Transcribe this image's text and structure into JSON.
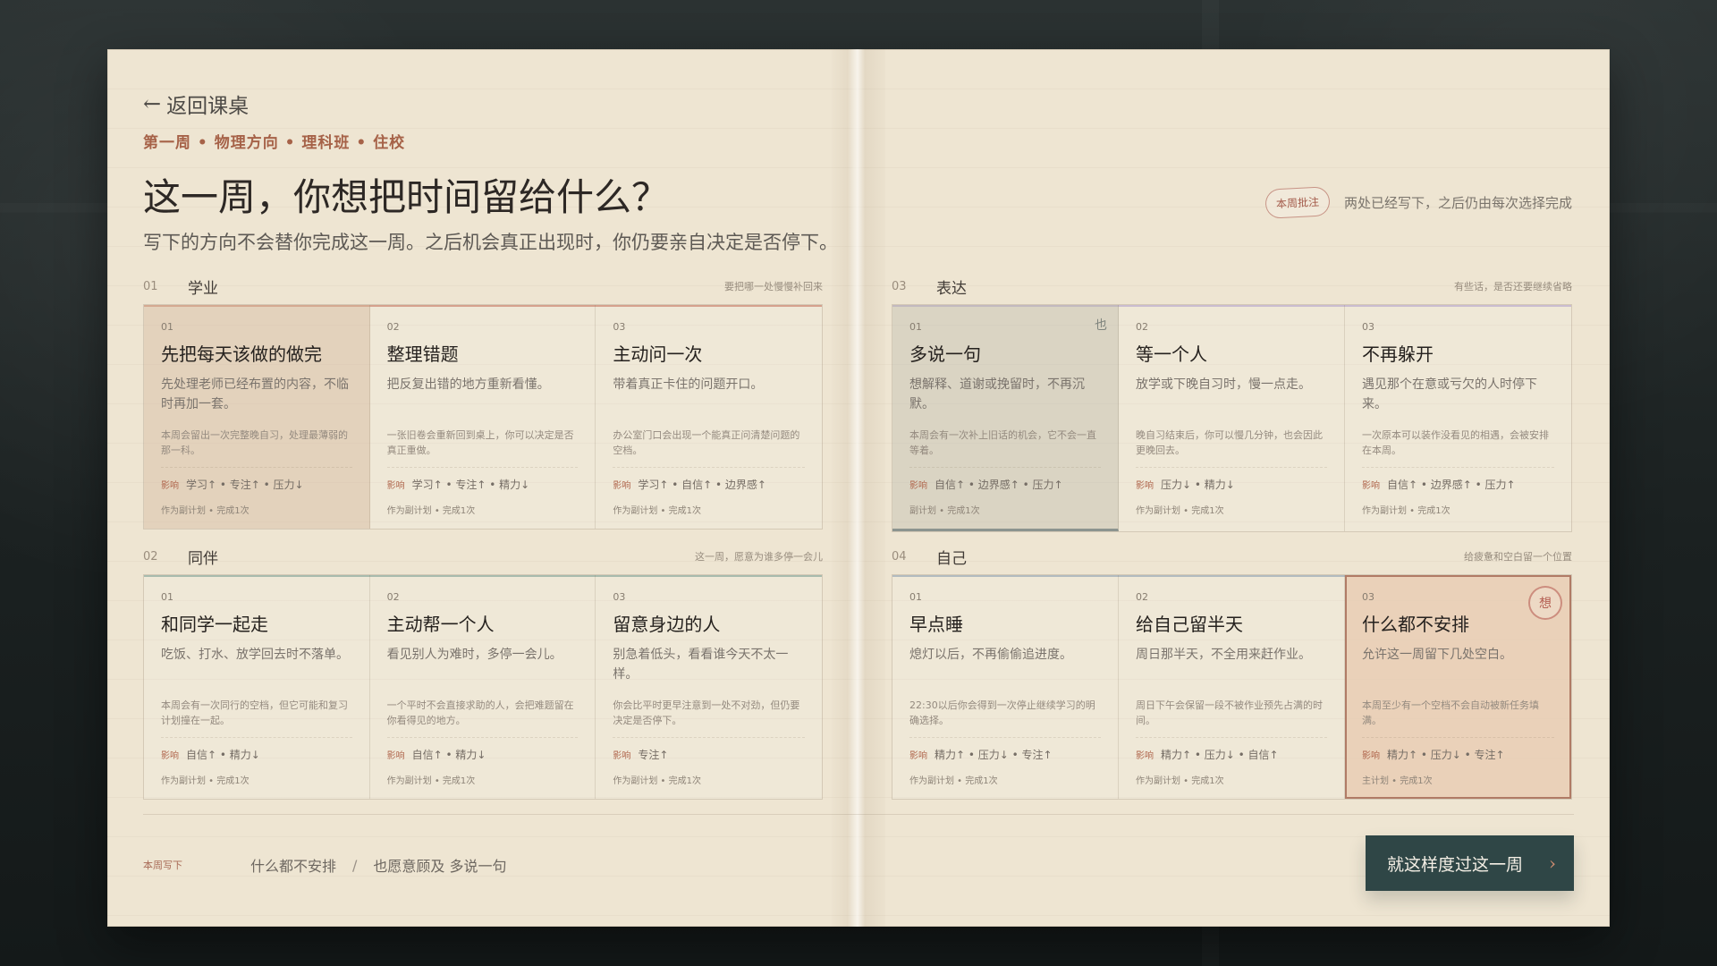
{
  "header": {
    "back_label": "返回课桌",
    "meta": "第一周 • 物理方向 • 理科班 • 住校",
    "title": "这一周，你想把时间留给什么？",
    "subtitle": "写下的方向不会替你完成这一周。之后机会真正出现时，你仍要亲自决定是否停下。"
  },
  "note": {
    "stamp": "本周批注",
    "text": "两处已经写下，之后仍由每次选择完成"
  },
  "sections": {
    "academic": {
      "num": "01",
      "label": "学业",
      "hint": "要把哪一处慢慢补回来",
      "cards": [
        {
          "num": "01",
          "title": "先把每天该做的做完",
          "desc": "先处理老师已经布置的内容，不临时再加一套。",
          "sub": "本周会留出一次完整晚自习，处理最薄弱的那一科。",
          "impact_label": "影响",
          "impact": "学习↑ • 专注↑ • 压力↓",
          "foot": "作为副计划 • 完成1次"
        },
        {
          "num": "02",
          "title": "整理错题",
          "desc": "把反复出错的地方重新看懂。",
          "sub": "一张旧卷会重新回到桌上，你可以决定是否真正重做。",
          "impact_label": "影响",
          "impact": "学习↑ • 专注↑ • 精力↓",
          "foot": "作为副计划 • 完成1次"
        },
        {
          "num": "03",
          "title": "主动问一次",
          "desc": "带着真正卡住的问题开口。",
          "sub": "办公室门口会出现一个能真正问清楚问题的空档。",
          "impact_label": "影响",
          "impact": "学习↑ • 自信↑ • 边界感↑",
          "foot": "作为副计划 • 完成1次"
        }
      ]
    },
    "peer": {
      "num": "02",
      "label": "同伴",
      "hint": "这一周，愿意为谁多停一会儿",
      "cards": [
        {
          "num": "01",
          "title": "和同学一起走",
          "desc": "吃饭、打水、放学回去时不落单。",
          "sub": "本周会有一次同行的空档，但它可能和复习计划撞在一起。",
          "impact_label": "影响",
          "impact": "自信↑ • 精力↓",
          "foot": "作为副计划 • 完成1次"
        },
        {
          "num": "02",
          "title": "主动帮一个人",
          "desc": "看见别人为难时，多停一会儿。",
          "sub": "一个平时不会直接求助的人，会把难题留在你看得见的地方。",
          "impact_label": "影响",
          "impact": "自信↑ • 精力↓",
          "foot": "作为副计划 • 完成1次"
        },
        {
          "num": "03",
          "title": "留意身边的人",
          "desc": "别急着低头，看看谁今天不太一样。",
          "sub": "你会比平时更早注意到一处不对劲，但仍要决定是否停下。",
          "impact_label": "影响",
          "impact": "专注↑",
          "foot": "作为副计划 • 完成1次"
        }
      ]
    },
    "expression": {
      "num": "03",
      "label": "表达",
      "hint": "有些话，是否还要继续省略",
      "cards": [
        {
          "num": "01",
          "title": "多说一句",
          "desc": "想解释、道谢或挽留时，不再沉默。",
          "sub": "本周会有一次补上旧话的机会，它不会一直等着。",
          "impact_label": "影响",
          "impact": "自信↑ • 边界感↑ • 压力↑",
          "foot": "副计划 • 完成1次",
          "badge": "也"
        },
        {
          "num": "02",
          "title": "等一个人",
          "desc": "放学或下晚自习时，慢一点走。",
          "sub": "晚自习结束后，你可以慢几分钟，也会因此更晚回去。",
          "impact_label": "影响",
          "impact": "压力↓ • 精力↓",
          "foot": "作为副计划 • 完成1次"
        },
        {
          "num": "03",
          "title": "不再躲开",
          "desc": "遇见那个在意或亏欠的人时停下来。",
          "sub": "一次原本可以装作没看见的相遇，会被安排在本周。",
          "impact_label": "影响",
          "impact": "自信↑ • 边界感↑ • 压力↑",
          "foot": "作为副计划 • 完成1次"
        }
      ]
    },
    "self": {
      "num": "04",
      "label": "自己",
      "hint": "给疲惫和空白留一个位置",
      "cards": [
        {
          "num": "01",
          "title": "早点睡",
          "desc": "熄灯以后，不再偷偷追进度。",
          "sub": "22:30以后你会得到一次停止继续学习的明确选择。",
          "impact_label": "影响",
          "impact": "精力↑ • 压力↓ • 专注↑",
          "foot": "作为副计划 • 完成1次"
        },
        {
          "num": "02",
          "title": "给自己留半天",
          "desc": "周日那半天，不全用来赶作业。",
          "sub": "周日下午会保留一段不被作业预先占满的时间。",
          "impact_label": "影响",
          "impact": "精力↑ • 压力↓ • 自信↑",
          "foot": "作为副计划 • 完成1次"
        },
        {
          "num": "03",
          "title": "什么都不安排",
          "desc": "允许这一周留下几处空白。",
          "sub": "本周至少有一个空档不会自动被新任务填满。",
          "impact_label": "影响",
          "impact": "精力↑ • 压力↓ • 专注↑",
          "foot": "主计划 • 完成1次",
          "badge": "想"
        }
      ]
    }
  },
  "footer": {
    "label": "本周写下",
    "choice_1": "什么都不安排",
    "slash": "/",
    "choice_2": "也愿意顾及 多说一句",
    "button_label": "就这样度过这一周",
    "button_arrow": "›"
  },
  "colors": {
    "background": "#1d2323",
    "paper": "#eee5d2",
    "accent": "#a66248",
    "button": "#2f4646"
  },
  "icons": {
    "back": "left-arrow-icon",
    "next": "chevron-right-icon"
  }
}
